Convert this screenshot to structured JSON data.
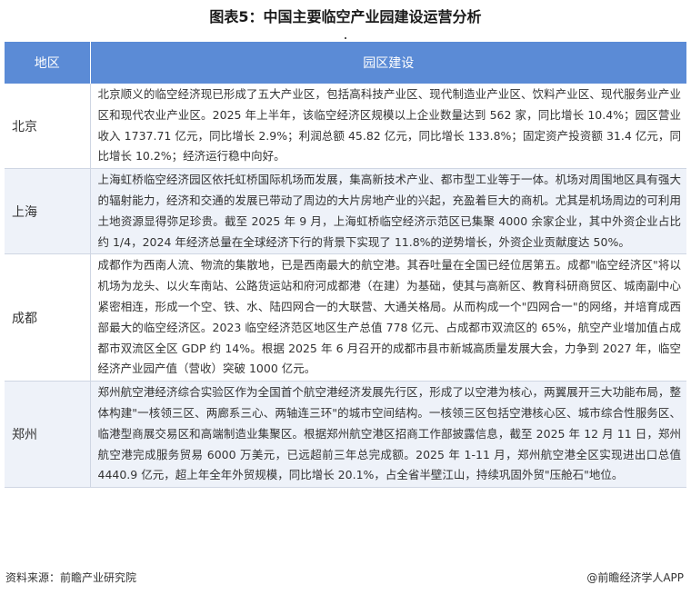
{
  "title": "图表5：中国主要临空产业园建设运营分析",
  "table": {
    "headers": [
      "地区",
      "园区建设"
    ],
    "rows": [
      {
        "region": "北京",
        "description": "北京顺义的临空经济现已形成了五大产业区，包括高科技产业区、现代制造业产业区、饮料产业区、现代服务业产业区和现代农业产业区。2025 年上半年，该临空经济区规模以上企业数量达到 562 家，同比增长 10.4%；园区营业收入 1737.71 亿元，同比增长 2.9%；利润总额 45.82 亿元，同比增长 133.8%；固定资产投资额 31.4 亿元，同比增长 10.2%；经济运行稳中向好。"
      },
      {
        "region": "上海",
        "description": "上海虹桥临空经济园区依托虹桥国际机场而发展，集高新技术产业、都市型工业等于一体。机场对周围地区具有强大的辐射能力，经济和交通的发展已带动了周边的大片房地产业的兴起，充盈着巨大的商机。尤其是机场周边的可利用土地资源显得弥足珍贵。截至 2025 年 9 月，上海虹桥临空经济示范区已集聚 4000 余家企业，其中外资企业占比约 1/4，2024 年经济总量在全球经济下行的背景下实现了 11.8%的逆势增长，外资企业贡献度达 50%。"
      },
      {
        "region": "成都",
        "description": "成都作为西南人流、物流的集散地，已是西南最大的航空港。其吞吐量在全国已经位居第五。成都\"临空经济区\"将以机场为龙头、以火车南站、公路货运站和府河成都港（在建）为基础，使其与高新区、教育科研商贸区、城南副中心紧密相连，形成一个空、铁、水、陆四网合一的大联营、大通关格局。从而构成一个\"四网合一\"的网络，并培育成西部最大的临空经济区。2023 临空经济范区地区生产总值 778 亿元、占成都市双流区的 65%，航空产业增加值占成都市双流区全区 GDP 约 14%。根据 2025 年 6 月召开的成都市县市新城高质量发展大会，力争到 2027 年，临空经济产业园产值（营收）突破 1000 亿元。"
      },
      {
        "region": "郑州",
        "description": "郑州航空港经济综合实验区作为全国首个航空港经济发展先行区，形成了以空港为核心，两翼展开三大功能布局，整体构建\"一核领三区、两廊系三心、两轴连三环\"的城市空间结构。一核领三区包括空港核心区、城市综合性服务区、临港型商展交易区和高端制造业集聚区。根据郑州航空港区招商工作部披露信息，截至 2025 年 12 月 11 日，郑州航空港完成服务贸易 6000 万美元，已远超前三年总完成额。2025 年 1-11 月，郑州航空港全区实现进出口总值 4440.9 亿元，超上年全年外贸规模，同比增长 20.1%，占全省半壁江山，持续巩固外贸\"压舱石\"地位。"
      }
    ]
  },
  "footer": {
    "source": "资料来源：前瞻产业研究院",
    "brand": "@前瞻经济学人APP"
  },
  "colors": {
    "header_bg": "#5b8bd6",
    "row_alt_bg": "#eef2f9"
  }
}
